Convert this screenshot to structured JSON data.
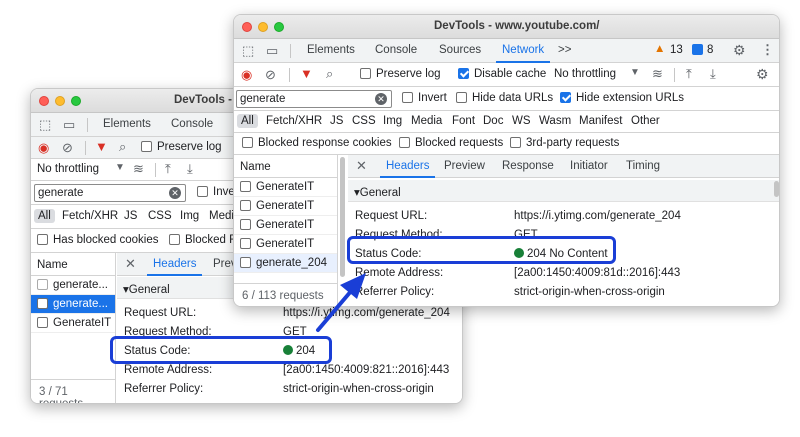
{
  "back": {
    "title": "DevTools - w",
    "tabs": [
      "Elements",
      "Console"
    ],
    "preserve_log": "Preserve log",
    "throttling": "No throttling",
    "search_value": "generate",
    "invert": "Inve",
    "filters": [
      "All",
      "Fetch/XHR",
      "JS",
      "CSS",
      "Img",
      "Media"
    ],
    "blocked_cookies": "Has blocked cookies",
    "blocked_requests": "Blocked R",
    "name_header": "Name",
    "rows": [
      "generate...",
      "generate...",
      "GenerateIT"
    ],
    "status": "3 / 71 requests",
    "detail_tabs": [
      "Headers",
      "Prev"
    ],
    "general": "General",
    "kv": [
      {
        "k": "Request URL:",
        "v": "https://i.ytimg.com/generate_204"
      },
      {
        "k": "Request Method:",
        "v": "GET"
      },
      {
        "k": "Status Code:",
        "v": "204"
      },
      {
        "k": "Remote Address:",
        "v": "[2a00:1450:4009:821::2016]:443"
      },
      {
        "k": "Referrer Policy:",
        "v": "strict-origin-when-cross-origin"
      }
    ]
  },
  "front": {
    "title": "DevTools - www.youtube.com/",
    "tabs": [
      "Elements",
      "Console",
      "Sources",
      "Network"
    ],
    "more": ">>",
    "warn_count": "13",
    "msg_count": "8",
    "preserve_log": "Preserve log",
    "disable_cache": "Disable cache",
    "throttling": "No throttling",
    "search_value": "generate",
    "invert": "Invert",
    "hide_data": "Hide data URLs",
    "hide_ext": "Hide extension URLs",
    "filters": [
      "All",
      "Fetch/XHR",
      "JS",
      "CSS",
      "Img",
      "Media",
      "Font",
      "Doc",
      "WS",
      "Wasm",
      "Manifest",
      "Other"
    ],
    "blocked_cookies": "Blocked response cookies",
    "blocked_requests": "Blocked requests",
    "third_party": "3rd-party requests",
    "name_header": "Name",
    "rows": [
      "GenerateIT",
      "GenerateIT",
      "GenerateIT",
      "GenerateIT",
      "generate_204"
    ],
    "status": "6 / 113 requests",
    "detail_tabs": [
      "Headers",
      "Preview",
      "Response",
      "Initiator",
      "Timing"
    ],
    "general": "General",
    "kv": [
      {
        "k": "Request URL:",
        "v": "https://i.ytimg.com/generate_204"
      },
      {
        "k": "Request Method:",
        "v": "GET"
      },
      {
        "k": "Status Code:",
        "v": "204 No Content"
      },
      {
        "k": "Remote Address:",
        "v": "[2a00:1450:4009:81d::2016]:443"
      },
      {
        "k": "Referrer Policy:",
        "v": "strict-origin-when-cross-origin"
      }
    ]
  },
  "colors": {
    "accent": "#1a73e8",
    "callout": "#1a3ed6",
    "status_ok": "#188038"
  }
}
